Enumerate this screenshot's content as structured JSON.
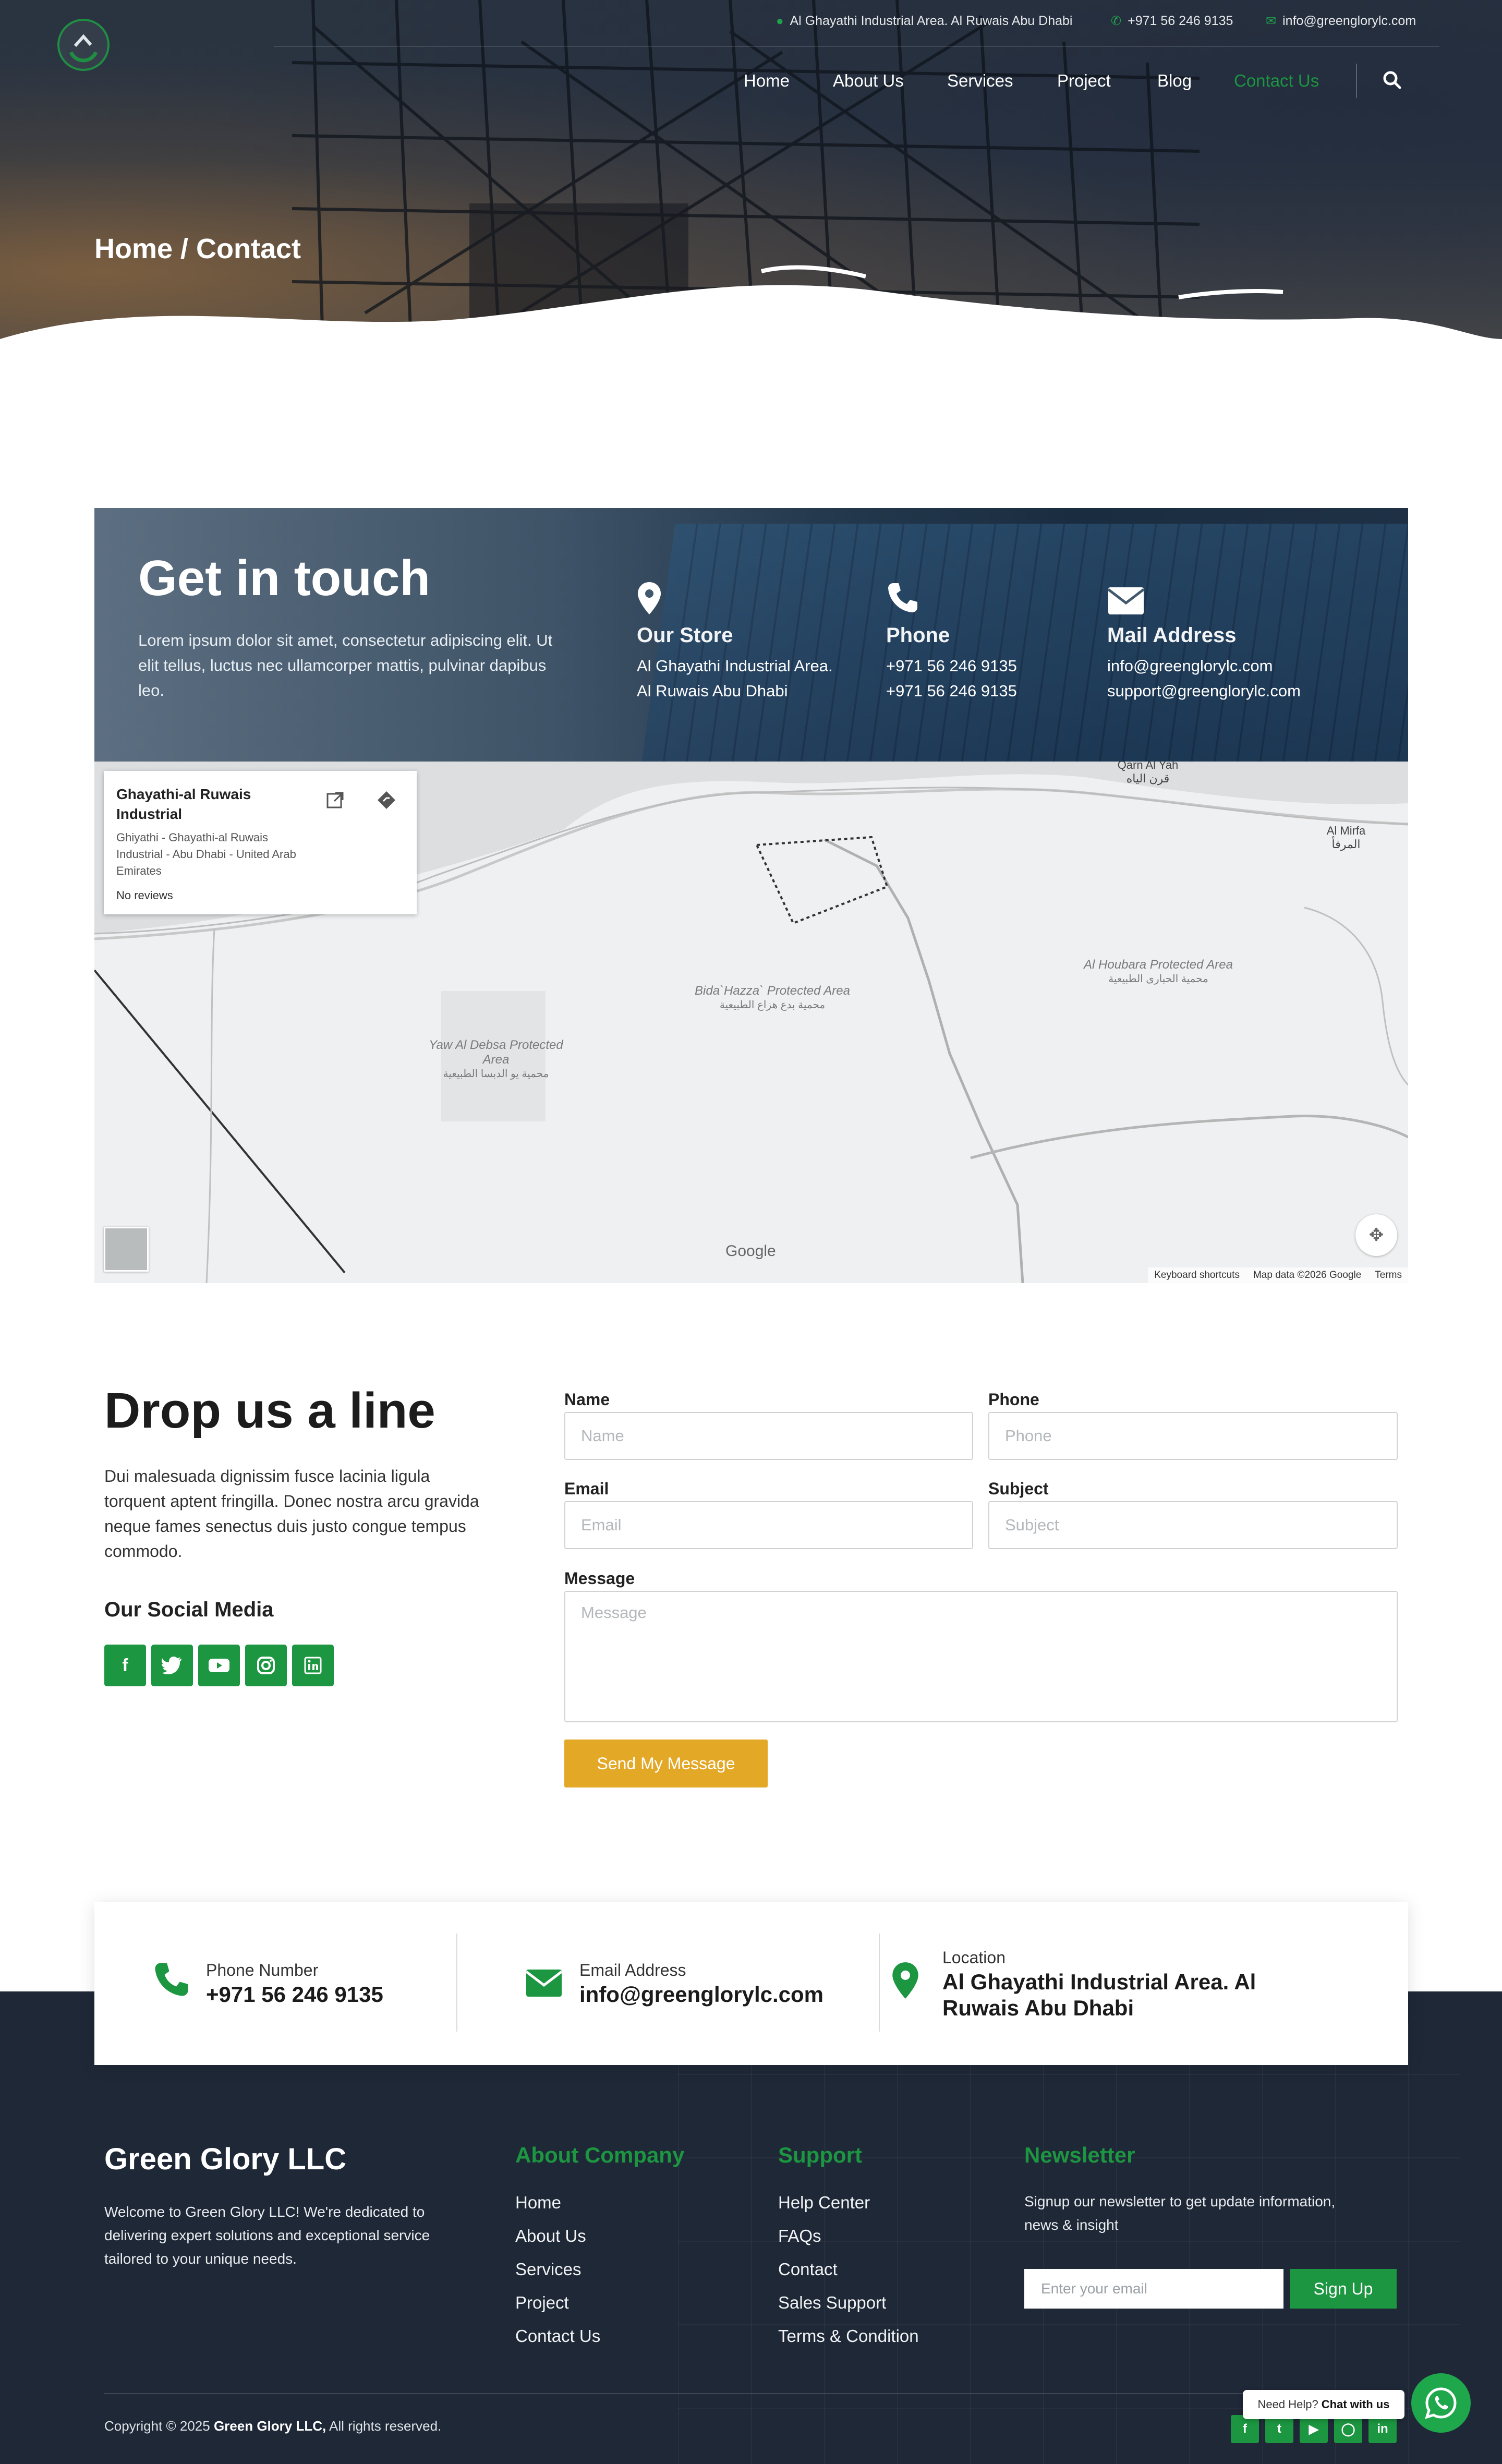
{
  "topbar": {
    "address": "Al Ghayathi Industrial Area. Al Ruwais Abu Dhabi",
    "phone": "+971 56 246 9135",
    "email": "info@greenglorylc.com"
  },
  "nav": {
    "items": [
      "Home",
      "About Us",
      "Services",
      "Project",
      "Blog",
      "Contact Us"
    ],
    "active": "Contact Us"
  },
  "hero": {
    "breadcrumb": "Home / Contact"
  },
  "get_in_touch": {
    "title": "Get in touch",
    "description": "Lorem ipsum dolor sit amet, consectetur adipiscing elit. Ut elit tellus, luctus nec ullamcorper mattis, pulvinar dapibus leo.",
    "store": {
      "heading": "Our Store",
      "line1": "Al Ghayathi Industrial Area.",
      "line2": "Al Ruwais Abu Dhabi"
    },
    "phone": {
      "heading": "Phone",
      "line1": "+971 56 246 9135",
      "line2": "+971 56 246 9135"
    },
    "mail": {
      "heading": "Mail Address",
      "line1": "info@greenglorylc.com",
      "line2": "support@greenglorylc.com"
    }
  },
  "map": {
    "card_title": "Ghayathi-al Ruwais Industrial",
    "card_address": "Ghiyathi - Ghayathi-al Ruwais Industrial - Abu Dhabi - United Arab Emirates",
    "card_reviews": "No reviews",
    "labels": {
      "bida": "Bida`Hazza` Protected Area",
      "bida_ar": "محمية بدع هزاع الطبيعية",
      "yaw": "Yaw Al Debsa Protected Area",
      "yaw_ar": "محمية يو الدبسا الطبيعية",
      "houbara": "Al Houbara Protected Area",
      "houbara_ar": "محمية الحبارى الطبيعية",
      "qarn": "Qarn Al Yah",
      "qarn_ar": "قرن الياه",
      "mirfa": "Al Mirfa",
      "mirfa_ar": "المرفأ"
    },
    "google": "Google",
    "footer": {
      "shortcuts": "Keyboard shortcuts",
      "data": "Map data ©2026 Google",
      "terms": "Terms"
    }
  },
  "contact": {
    "title": "Drop us a line",
    "description": "Dui malesuada dignissim fusce lacinia ligula torquent aptent fringilla. Donec nostra arcu gravida neque fames senectus duis justo congue tempus commodo.",
    "social_heading": "Our Social Media",
    "form": {
      "name_label": "Name",
      "name_placeholder": "Name",
      "phone_label": "Phone",
      "phone_placeholder": "Phone",
      "email_label": "Email",
      "email_placeholder": "Email",
      "subject_label": "Subject",
      "subject_placeholder": "Subject",
      "message_label": "Message",
      "message_placeholder": "Message",
      "submit": "Send My Message"
    }
  },
  "strip": {
    "phone_label": "Phone Number",
    "phone_value": "+971 56 246 9135",
    "email_label": "Email Address",
    "email_value": "info@greenglorylc.com",
    "location_label": "Location",
    "location_value": "Al Ghayathi Industrial Area. Al Ruwais Abu Dhabi"
  },
  "footer": {
    "brand": "Green Glory LLC",
    "brand_desc": "Welcome to Green Glory LLC! We're dedicated to delivering expert solutions and exceptional service tailored to your unique needs.",
    "about_heading": "About Company",
    "about_links": [
      "Home",
      "About Us",
      "Services",
      "Project",
      "Contact Us"
    ],
    "support_heading": "Support",
    "support_links": [
      "Help Center",
      "FAQs",
      "Contact",
      "Sales Support",
      "Terms & Condition"
    ],
    "newsletter_heading": "Newsletter",
    "newsletter_desc": "Signup our newsletter to get update information, news & insight",
    "email_placeholder": "Enter your email",
    "signup": "Sign Up",
    "copyright_pre": "Copyright © 2025",
    "copyright_brand": "Green Glory LLC,",
    "copyright_post": "All rights reserved."
  },
  "chat": {
    "help": "Need Help?",
    "cta": "Chat with us"
  },
  "colors": {
    "brand_green": "#1c9640",
    "accent_gold": "#e4a827",
    "footer_bg": "#1f2837"
  }
}
